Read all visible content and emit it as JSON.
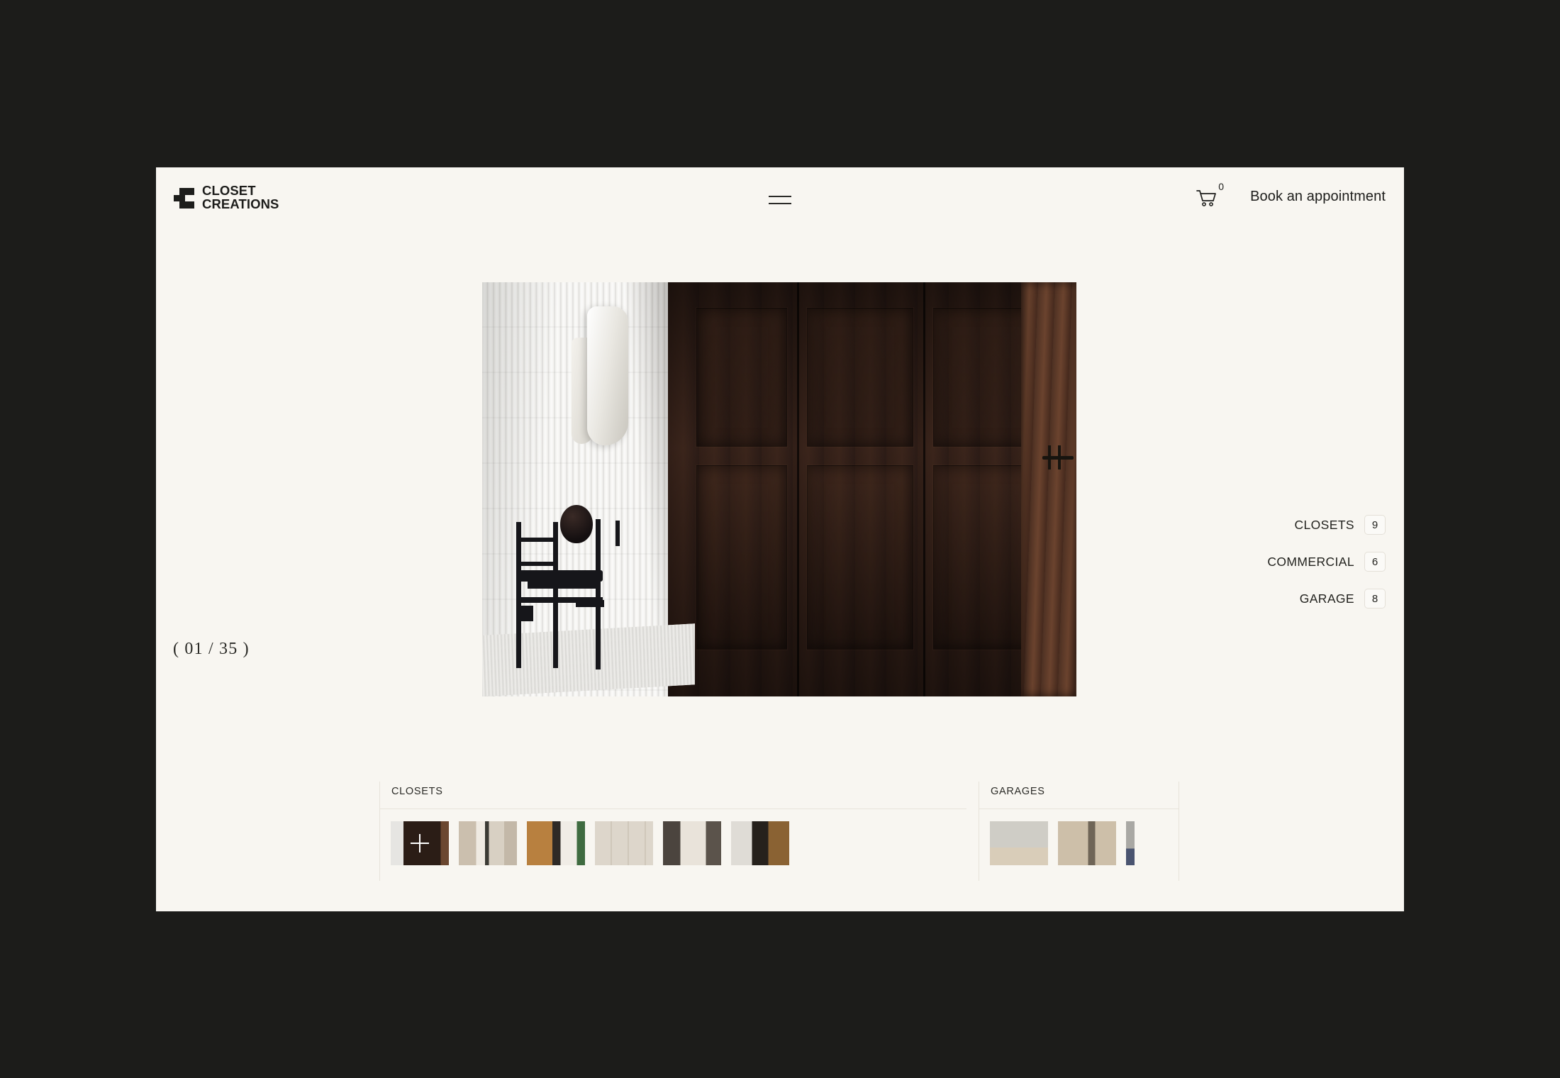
{
  "theme": {
    "page_background": "#1c1c1a",
    "card_background": "#f8f6f1",
    "text_color": "#1d1d1b",
    "border_color": "#e7e3da"
  },
  "header": {
    "logo": {
      "line1": "CLOSET",
      "line2": "CREATIONS",
      "mark_icon": "closet-creations-logo-icon"
    },
    "menu_icon": "hamburger-menu-icon",
    "cart": {
      "icon": "shopping-cart-icon",
      "count": "0"
    },
    "book_label": "Book an appointment"
  },
  "gallery": {
    "counter": "( 01  /  35 )",
    "current_index": "01",
    "total": "35",
    "hero_alt": "closet-hero-image"
  },
  "categories": [
    {
      "label": "CLOSETS",
      "count": "9"
    },
    {
      "label": "COMMERCIAL",
      "count": "6"
    },
    {
      "label": "GARAGE",
      "count": "8"
    }
  ],
  "strip": {
    "groups": [
      {
        "title": "CLOSETS",
        "thumbs": [
          {
            "name": "thumb-closet-dark-wood",
            "art": "t-dark",
            "active": true
          },
          {
            "name": "thumb-closet-corridor",
            "art": "t-corridor",
            "active": false
          },
          {
            "name": "thumb-closet-wood-entry",
            "art": "t-wood",
            "active": false
          },
          {
            "name": "thumb-closet-white",
            "art": "t-white",
            "active": false
          },
          {
            "name": "thumb-closet-vanity",
            "art": "t-mirror",
            "active": false
          },
          {
            "name": "thumb-closet-glass",
            "art": "t-glass",
            "active": false
          }
        ]
      },
      {
        "title": "GARAGES",
        "thumbs": [
          {
            "name": "thumb-garage-empty",
            "art": "t-garage1",
            "active": false
          },
          {
            "name": "thumb-garage-shelving",
            "art": "t-garage2",
            "active": false
          },
          {
            "name": "thumb-garage-partial",
            "art": "t-garage3",
            "active": false
          }
        ]
      }
    ],
    "plus_icon": "plus-overlay-icon"
  }
}
